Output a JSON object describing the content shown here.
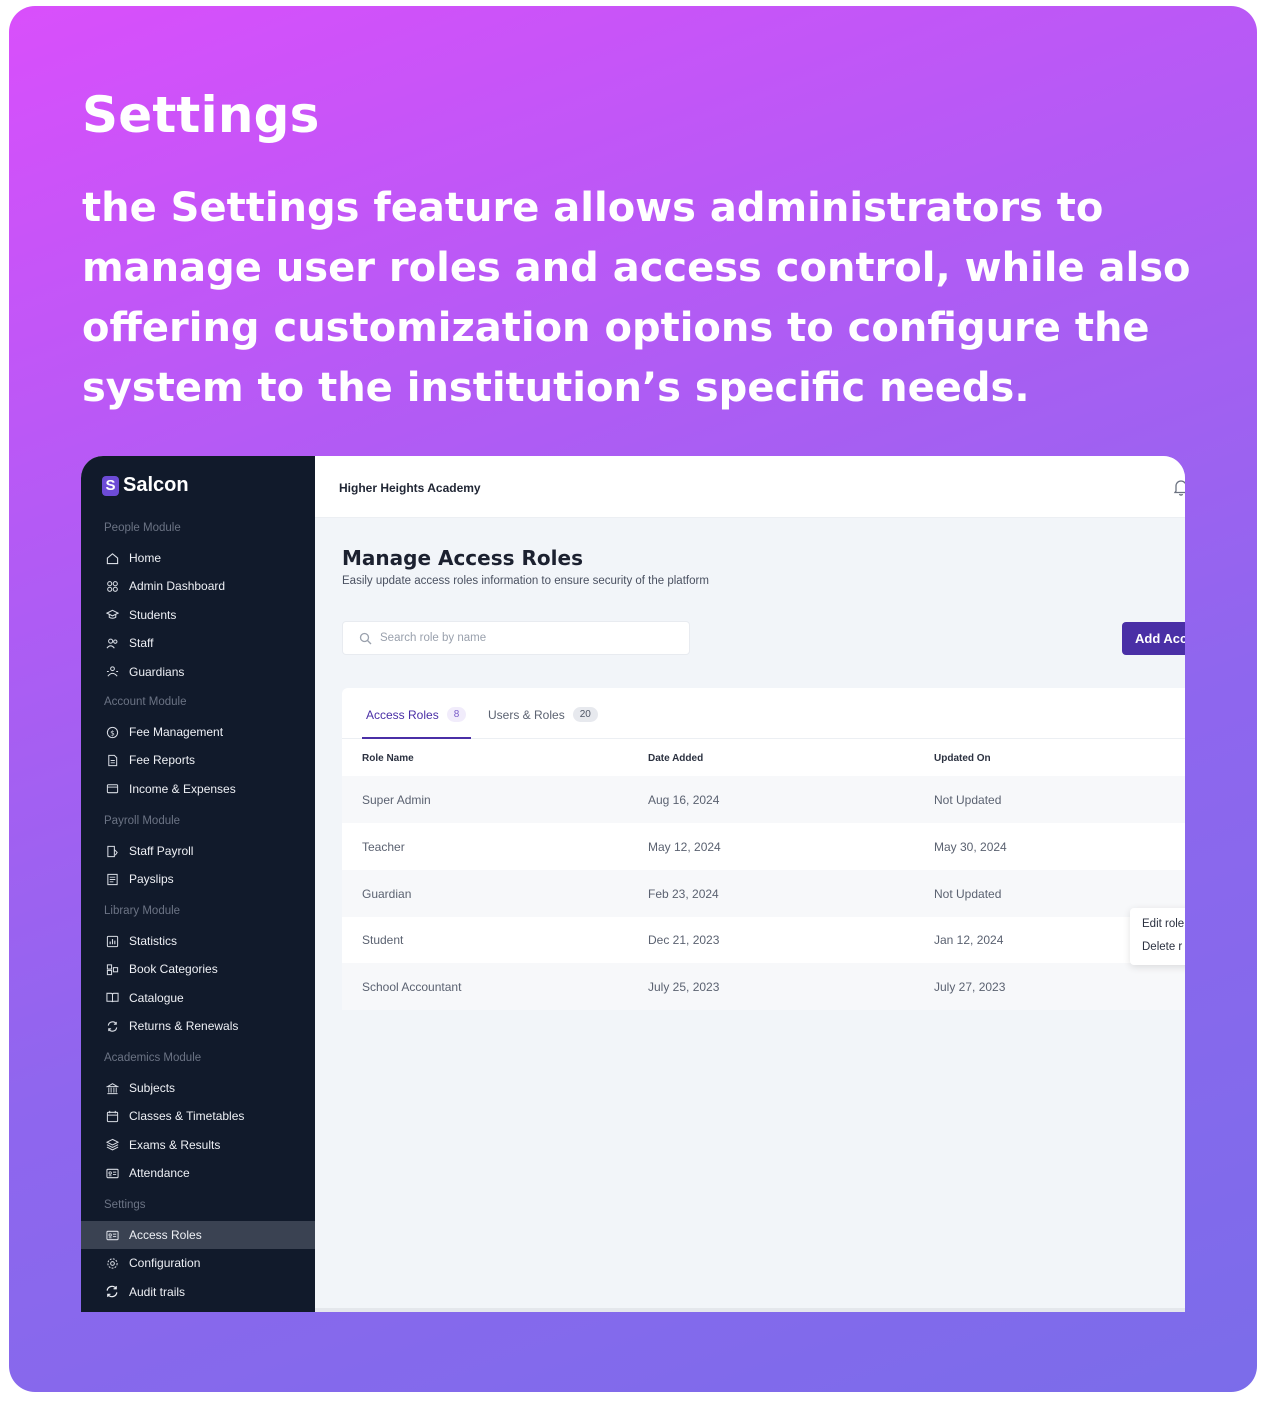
{
  "hero": {
    "title": "Settings",
    "description": "the Settings feature allows administrators to manage user roles and access control, while also offering customization options to configure the system to the institution’s specific needs."
  },
  "app": {
    "logo": {
      "mark": "S",
      "name": "Salcon"
    },
    "school_name": "Higher Heights Academy",
    "sidebar": {
      "sections": [
        {
          "label": "People Module",
          "items": [
            {
              "label": "Home",
              "icon": "home-icon"
            },
            {
              "label": "Admin Dashboard",
              "icon": "dashboard-icon"
            },
            {
              "label": "Students",
              "icon": "graduation-cap-icon"
            },
            {
              "label": "Staff",
              "icon": "users-icon"
            },
            {
              "label": "Guardians",
              "icon": "guardians-icon"
            }
          ]
        },
        {
          "label": "Account Module",
          "items": [
            {
              "label": "Fee Management",
              "icon": "dollar-icon"
            },
            {
              "label": "Fee Reports",
              "icon": "document-icon"
            },
            {
              "label": "Income & Expenses",
              "icon": "wallet-icon"
            }
          ]
        },
        {
          "label": "Payroll Module",
          "items": [
            {
              "label": "Staff Payroll",
              "icon": "payroll-icon"
            },
            {
              "label": "Payslips",
              "icon": "payslip-icon"
            }
          ]
        },
        {
          "label": "Library Module",
          "items": [
            {
              "label": "Statistics",
              "icon": "chart-icon"
            },
            {
              "label": "Book Categories",
              "icon": "categories-icon"
            },
            {
              "label": "Catalogue",
              "icon": "book-open-icon"
            },
            {
              "label": "Returns & Renewals",
              "icon": "refresh-icon"
            }
          ]
        },
        {
          "label": "Academics Module",
          "items": [
            {
              "label": "Subjects",
              "icon": "building-icon"
            },
            {
              "label": "Classes & Timetables",
              "icon": "calendar-icon"
            },
            {
              "label": "Exams & Results",
              "icon": "layers-icon"
            },
            {
              "label": "Attendance",
              "icon": "id-card-icon"
            }
          ]
        },
        {
          "label": "Settings",
          "items": [
            {
              "label": "Access Roles",
              "icon": "id-card-icon",
              "active": true
            },
            {
              "label": "Configuration",
              "icon": "gear-icon"
            },
            {
              "label": "Audit trails",
              "icon": "sync-icon"
            }
          ]
        }
      ]
    },
    "page": {
      "title": "Manage Access Roles",
      "subtitle": "Easily update access roles information to ensure security of the platform",
      "search_placeholder": "Search role by name",
      "add_button": "Add Acc"
    },
    "tabs": [
      {
        "label": "Access Roles",
        "count": "8",
        "active": true
      },
      {
        "label": "Users & Roles",
        "count": "20",
        "active": false
      }
    ],
    "table": {
      "columns": [
        "Role Name",
        "Date Added",
        "Updated On"
      ],
      "rows": [
        [
          "Super Admin",
          "Aug 16, 2024",
          "Not Updated"
        ],
        [
          "Teacher",
          "May 12, 2024",
          "May 30, 2024"
        ],
        [
          "Guardian",
          "Feb 23, 2024",
          "Not Updated"
        ],
        [
          "Student",
          "Dec 21, 2023",
          "Jan 12, 2024"
        ],
        [
          "School Accountant",
          "July 25, 2023",
          "July 27, 2023"
        ]
      ]
    },
    "context_menu": [
      "Edit role",
      "Delete r"
    ]
  }
}
